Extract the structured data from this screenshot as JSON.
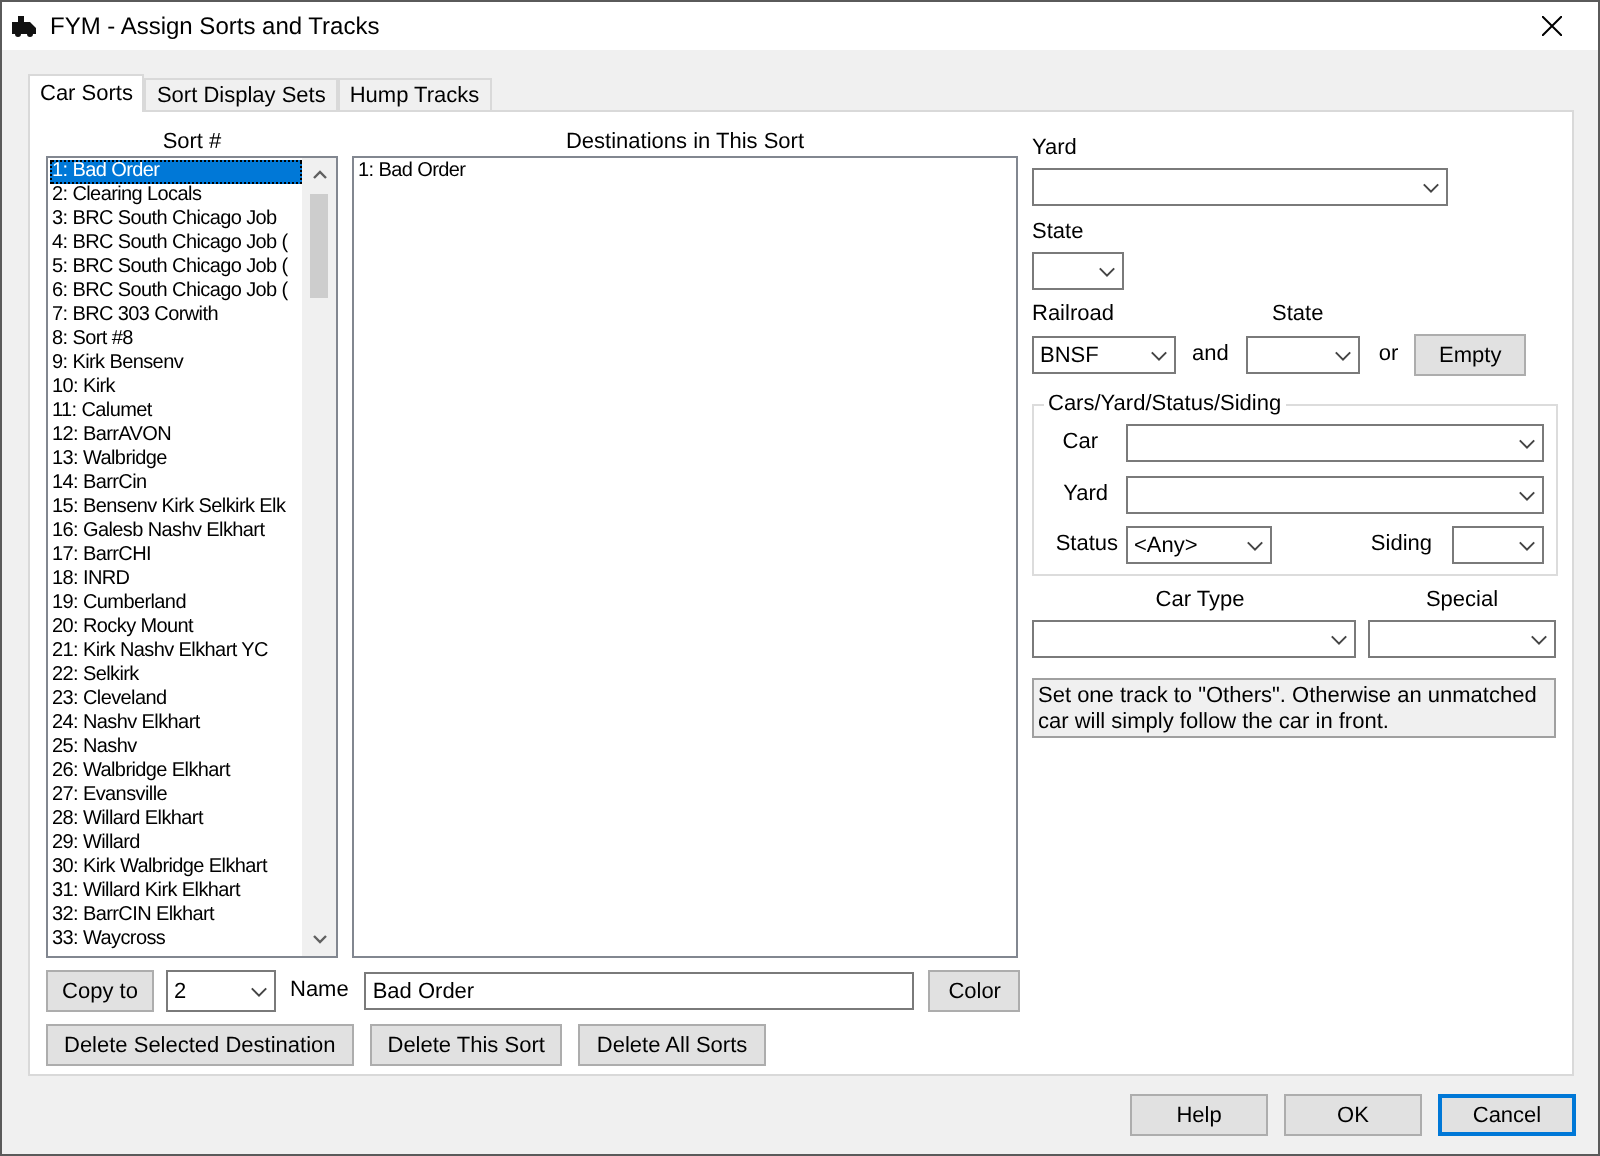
{
  "window": {
    "title": "FYM - Assign Sorts and Tracks"
  },
  "tabs": [
    {
      "label": "Car Sorts",
      "selected": true
    },
    {
      "label": "Sort Display Sets",
      "selected": false
    },
    {
      "label": "Hump Tracks",
      "selected": false
    }
  ],
  "sort_list": {
    "header": "Sort #",
    "items": [
      {
        "label": "1: Bad Order",
        "selected": true
      },
      {
        "label": "2: Clearing Locals",
        "selected": false
      },
      {
        "label": "3: BRC South Chicago Job",
        "selected": false
      },
      {
        "label": "4: BRC South Chicago Job (",
        "selected": false
      },
      {
        "label": "5: BRC South Chicago Job (",
        "selected": false
      },
      {
        "label": "6: BRC South Chicago Job (",
        "selected": false
      },
      {
        "label": "7: BRC 303 Corwith",
        "selected": false
      },
      {
        "label": "8: Sort #8",
        "selected": false
      },
      {
        "label": "9: Kirk Bensenv",
        "selected": false
      },
      {
        "label": "10: Kirk",
        "selected": false
      },
      {
        "label": "11: Calumet",
        "selected": false
      },
      {
        "label": "12: BarrAVON",
        "selected": false
      },
      {
        "label": "13: Walbridge",
        "selected": false
      },
      {
        "label": "14: BarrCin",
        "selected": false
      },
      {
        "label": "15: Bensenv Kirk Selkirk Elk",
        "selected": false
      },
      {
        "label": "16: Galesb Nashv Elkhart",
        "selected": false
      },
      {
        "label": "17: BarrCHI",
        "selected": false
      },
      {
        "label": "18: INRD",
        "selected": false
      },
      {
        "label": "19: Cumberland",
        "selected": false
      },
      {
        "label": "20: Rocky Mount",
        "selected": false
      },
      {
        "label": "21: Kirk Nashv Elkhart YC",
        "selected": false
      },
      {
        "label": "22: Selkirk",
        "selected": false
      },
      {
        "label": "23: Cleveland",
        "selected": false
      },
      {
        "label": "24: Nashv Elkhart",
        "selected": false
      },
      {
        "label": "25: Nashv",
        "selected": false
      },
      {
        "label": "26: Walbridge Elkhart",
        "selected": false
      },
      {
        "label": "27: Evansville",
        "selected": false
      },
      {
        "label": "28: Willard Elkhart",
        "selected": false
      },
      {
        "label": "29: Willard",
        "selected": false
      },
      {
        "label": "30: Kirk Walbridge Elkhart",
        "selected": false
      },
      {
        "label": "31: Willard Kirk Elkhart",
        "selected": false
      },
      {
        "label": "32: BarrCIN Elkhart",
        "selected": false
      },
      {
        "label": "33: Waycross",
        "selected": false
      }
    ]
  },
  "destinations": {
    "header": "Destinations in This Sort",
    "items": [
      {
        "label": "1: Bad Order",
        "selected": false
      }
    ]
  },
  "copy_to": {
    "button": "Copy to",
    "value": "2"
  },
  "name_field": {
    "label": "Name",
    "value": "Bad Order"
  },
  "color_button": "Color",
  "delete_buttons": [
    "Delete Selected Destination",
    "Delete This Sort",
    "Delete All Sorts"
  ],
  "yard": {
    "label": "Yard"
  },
  "state": {
    "label": "State"
  },
  "railroad": {
    "label": "Railroad",
    "value": "BNSF"
  },
  "railroad_state": {
    "label": "State"
  },
  "and_text": "and",
  "or_text": "or",
  "empty_button": "Empty",
  "group": {
    "title": "Cars/Yard/Status/Siding",
    "car": {
      "label": "Car"
    },
    "yard": {
      "label": "Yard"
    },
    "status": {
      "label": "Status",
      "value": "<Any>"
    },
    "siding": {
      "label": "Siding"
    }
  },
  "car_type": {
    "label": "Car Type"
  },
  "special": {
    "label": "Special"
  },
  "note": "Set one track to \"Others\". Otherwise an unmatched car will simply follow the car in front.",
  "buttons": [
    {
      "label": "Help",
      "focused": false
    },
    {
      "label": "OK",
      "focused": false
    },
    {
      "label": "Cancel",
      "focused": true
    }
  ]
}
